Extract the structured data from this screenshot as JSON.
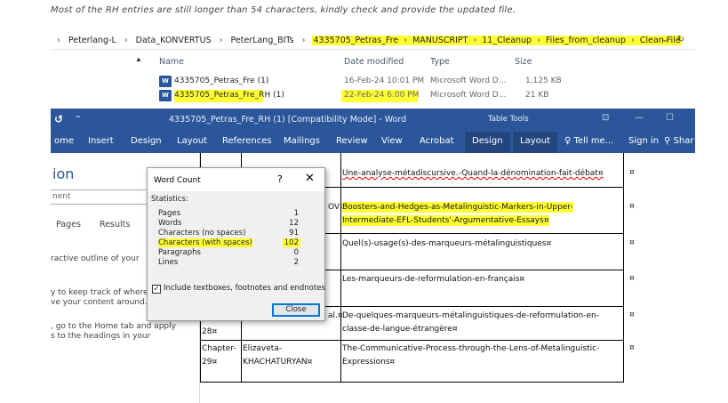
{
  "note": "Most of the RH entries are still longer than 54 characters, kindly check and provide the updated file.",
  "explorer": {
    "breadcrumbs": [
      {
        "label": "Peterlang-L",
        "hl": false
      },
      {
        "label": "Data_KONVERTUS",
        "hl": false
      },
      {
        "label": "PeterLang_BITs",
        "hl": false
      },
      {
        "label": "4335705_Petras_Fre",
        "hl": true
      },
      {
        "label": "MANUSCRIPT",
        "hl": true
      },
      {
        "label": "11_Cleanup",
        "hl": true
      },
      {
        "label": "Files_from_cleanup",
        "hl": true
      },
      {
        "label": "Clean File",
        "hl": true
      }
    ],
    "columns": {
      "name": "Name",
      "date": "Date modified",
      "type": "Type",
      "size": "Size"
    },
    "files": [
      {
        "name": "4335705_Petras_Fre (1)",
        "date": "16-Feb-24 10:01 PM",
        "type": "Microsoft Word D...",
        "size": "1,125 KB"
      },
      {
        "name": "4335705_Petras_Fre_RH (1)",
        "date": "22-Feb-24 6:00 PM",
        "type": "Microsoft Word D...",
        "size": "21 KB"
      }
    ]
  },
  "word": {
    "title": "4335705_Petras_Fre_RH (1) [Compatibility Mode] - Word",
    "table_tools": "Table Tools",
    "tabs": {
      "home": "ome",
      "insert": "Insert",
      "design": "Design",
      "layout": "Layout",
      "references": "References",
      "mailings": "Mailings",
      "review": "Review",
      "view": "View",
      "acrobat": "Acrobat",
      "tt_design": "Design",
      "tt_layout": "Layout",
      "tell_me": "Tell me...",
      "sign_in": "Sign in",
      "share": "Shar"
    }
  },
  "nav": {
    "title": "ion",
    "search": "nent",
    "tabs": [
      "Pages",
      "Results"
    ],
    "lines": [
      "ractive outline of your",
      "y to keep track of where y",
      "ve your content around.",
      ", go to the Home tab and apply",
      "s to the headings in your"
    ]
  },
  "doc": {
    "titles": [
      "Une-analyse-métadiscursive.-Quand-la-dénomination-fait-débat¤",
      "Boosters-and-Hedges-as-Metalinguistic-Markers-in-Upper-",
      "Intermediate-EFL-Students'-Argumentative-Essays¤",
      "Quel(s)-usage(s)-des-marqueurs-métalinguistiques¤",
      "Les-marqueurs-de-reformulation-en-français¤",
      "De-quelques-marqueurs-métalinguistiques-de-reformulation-en-",
      "classe-de-langue-étrangère¤",
      "The-Communicative-Process-through-the-Lens-of-Metalinguistic-",
      "Expressions¤"
    ],
    "frag_ov": "OV¤",
    "frag_al": "al.¤",
    "chapter_28": "28¤",
    "chapter_label": "Chapter-",
    "chapter_29": "29¤",
    "author_first": "Elizaveta-",
    "author_last": "KHACHATURYAN¤",
    "cell_mark": "¤"
  },
  "dialog": {
    "title": "Word Count",
    "help": "?",
    "close_x": "✕",
    "statistics_label": "Statistics:",
    "stats": [
      {
        "label": "Pages",
        "value": "1"
      },
      {
        "label": "Words",
        "value": "12"
      },
      {
        "label": "Characters (no spaces)",
        "value": "91"
      },
      {
        "label": "Characters (with spaces)",
        "value": "102"
      },
      {
        "label": "Paragraphs",
        "value": "0"
      },
      {
        "label": "Lines",
        "value": "2"
      }
    ],
    "include_label": "Include textboxes, footnotes and endnotes",
    "include_checked": true,
    "close_button": "Close"
  },
  "colors": {
    "word_blue": "#2b579a",
    "highlight": "#ffff33"
  }
}
